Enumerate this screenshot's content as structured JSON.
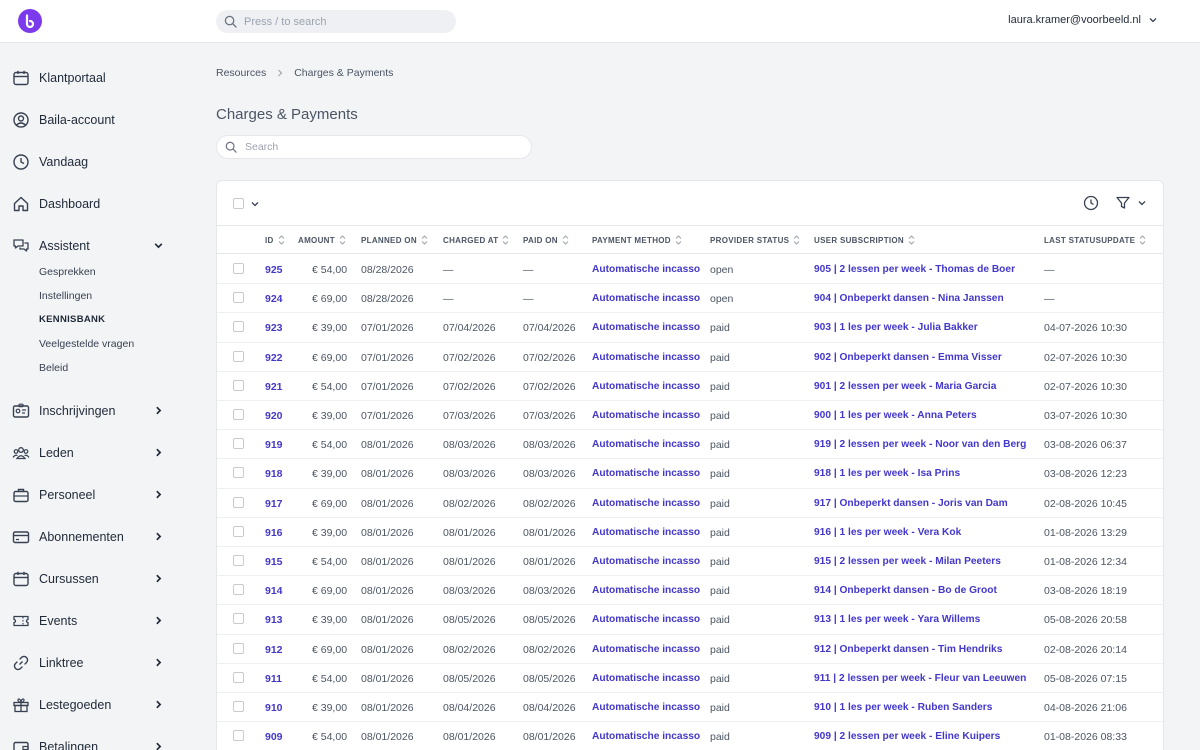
{
  "topbar": {
    "search_placeholder": "Press / to search",
    "user_email": "laura.kramer@voorbeeld.nl"
  },
  "sidebar": {
    "items": [
      {
        "label": "Klantportaal",
        "icon": "calendar-icon",
        "chevron": false
      },
      {
        "label": "Baila-account",
        "icon": "user-circle-icon",
        "chevron": false
      },
      {
        "label": "Vandaag",
        "icon": "clock-icon",
        "chevron": false
      },
      {
        "label": "Dashboard",
        "icon": "home-icon",
        "chevron": false
      },
      {
        "label": "Assistent",
        "icon": "chat-icon",
        "chevron": "down"
      },
      {
        "label": "Inschrijvingen",
        "icon": "id-card-icon",
        "chevron": "right"
      },
      {
        "label": "Leden",
        "icon": "users-icon",
        "chevron": "right"
      },
      {
        "label": "Personeel",
        "icon": "briefcase-icon",
        "chevron": "right"
      },
      {
        "label": "Abonnementen",
        "icon": "credit-card-icon",
        "chevron": "right"
      },
      {
        "label": "Cursussen",
        "icon": "calendar-icon",
        "chevron": "right"
      },
      {
        "label": "Events",
        "icon": "ticket-icon",
        "chevron": "right"
      },
      {
        "label": "Linktree",
        "icon": "link-icon",
        "chevron": "right"
      },
      {
        "label": "Lestegoeden",
        "icon": "gift-icon",
        "chevron": "right"
      },
      {
        "label": "Betalingen",
        "icon": "wallet-icon",
        "chevron": "right"
      }
    ],
    "assistent_sub": [
      {
        "label": "Gesprekken",
        "active": false
      },
      {
        "label": "Instellingen",
        "active": false
      },
      {
        "label": "KENNISBANK",
        "active": true
      },
      {
        "label": "Veelgestelde vragen",
        "active": false
      },
      {
        "label": "Beleid",
        "active": false
      }
    ]
  },
  "breadcrumb": {
    "root": "Resources",
    "current": "Charges & Payments"
  },
  "page": {
    "title": "Charges & Payments",
    "search_placeholder": "Search"
  },
  "table": {
    "columns": [
      "ID",
      "AMOUNT",
      "PLANNED ON",
      "CHARGED AT",
      "PAID ON",
      "PAYMENT METHOD",
      "PROVIDER STATUS",
      "USER SUBSCRIPTION",
      "LAST STATUSUPDATE"
    ],
    "rows": [
      {
        "id": "925",
        "amount": "€ 54,00",
        "planned": "08/28/2026",
        "charged": "—",
        "paid": "—",
        "method": "Automatische incasso",
        "status": "open",
        "subscription": "905 | 2 lessen per week - Thomas de Boer",
        "update": "—"
      },
      {
        "id": "924",
        "amount": "€ 69,00",
        "planned": "08/28/2026",
        "charged": "—",
        "paid": "—",
        "method": "Automatische incasso",
        "status": "open",
        "subscription": "904 | Onbeperkt dansen - Nina Janssen",
        "update": "—"
      },
      {
        "id": "923",
        "amount": "€ 39,00",
        "planned": "07/01/2026",
        "charged": "07/04/2026",
        "paid": "07/04/2026",
        "method": "Automatische incasso",
        "status": "paid",
        "subscription": "903 | 1 les per week - Julia Bakker",
        "update": "04-07-2026 10:30"
      },
      {
        "id": "922",
        "amount": "€ 69,00",
        "planned": "07/01/2026",
        "charged": "07/02/2026",
        "paid": "07/02/2026",
        "method": "Automatische incasso",
        "status": "paid",
        "subscription": "902 | Onbeperkt dansen - Emma Visser",
        "update": "02-07-2026 10:30"
      },
      {
        "id": "921",
        "amount": "€ 54,00",
        "planned": "07/01/2026",
        "charged": "07/02/2026",
        "paid": "07/02/2026",
        "method": "Automatische incasso",
        "status": "paid",
        "subscription": "901 | 2 lessen per week - Maria Garcia",
        "update": "02-07-2026 10:30"
      },
      {
        "id": "920",
        "amount": "€ 39,00",
        "planned": "07/01/2026",
        "charged": "07/03/2026",
        "paid": "07/03/2026",
        "method": "Automatische incasso",
        "status": "paid",
        "subscription": "900 | 1 les per week - Anna Peters",
        "update": "03-07-2026 10:30"
      },
      {
        "id": "919",
        "amount": "€ 54,00",
        "planned": "08/01/2026",
        "charged": "08/03/2026",
        "paid": "08/03/2026",
        "method": "Automatische incasso",
        "status": "paid",
        "subscription": "919 | 2 lessen per week - Noor van den Berg",
        "update": "03-08-2026 06:37"
      },
      {
        "id": "918",
        "amount": "€ 39,00",
        "planned": "08/01/2026",
        "charged": "08/03/2026",
        "paid": "08/03/2026",
        "method": "Automatische incasso",
        "status": "paid",
        "subscription": "918 | 1 les per week - Isa Prins",
        "update": "03-08-2026 12:23"
      },
      {
        "id": "917",
        "amount": "€ 69,00",
        "planned": "08/01/2026",
        "charged": "08/02/2026",
        "paid": "08/02/2026",
        "method": "Automatische incasso",
        "status": "paid",
        "subscription": "917 | Onbeperkt dansen - Joris van Dam",
        "update": "02-08-2026 10:45"
      },
      {
        "id": "916",
        "amount": "€ 39,00",
        "planned": "08/01/2026",
        "charged": "08/01/2026",
        "paid": "08/01/2026",
        "method": "Automatische incasso",
        "status": "paid",
        "subscription": "916 | 1 les per week - Vera Kok",
        "update": "01-08-2026 13:29"
      },
      {
        "id": "915",
        "amount": "€ 54,00",
        "planned": "08/01/2026",
        "charged": "08/01/2026",
        "paid": "08/01/2026",
        "method": "Automatische incasso",
        "status": "paid",
        "subscription": "915 | 2 lessen per week - Milan Peeters",
        "update": "01-08-2026 12:34"
      },
      {
        "id": "914",
        "amount": "€ 69,00",
        "planned": "08/01/2026",
        "charged": "08/03/2026",
        "paid": "08/03/2026",
        "method": "Automatische incasso",
        "status": "paid",
        "subscription": "914 | Onbeperkt dansen - Bo de Groot",
        "update": "03-08-2026 18:19"
      },
      {
        "id": "913",
        "amount": "€ 39,00",
        "planned": "08/01/2026",
        "charged": "08/05/2026",
        "paid": "08/05/2026",
        "method": "Automatische incasso",
        "status": "paid",
        "subscription": "913 | 1 les per week - Yara Willems",
        "update": "05-08-2026 20:58"
      },
      {
        "id": "912",
        "amount": "€ 69,00",
        "planned": "08/01/2026",
        "charged": "08/02/2026",
        "paid": "08/02/2026",
        "method": "Automatische incasso",
        "status": "paid",
        "subscription": "912 | Onbeperkt dansen - Tim Hendriks",
        "update": "02-08-2026 20:14"
      },
      {
        "id": "911",
        "amount": "€ 54,00",
        "planned": "08/01/2026",
        "charged": "08/05/2026",
        "paid": "08/05/2026",
        "method": "Automatische incasso",
        "status": "paid",
        "subscription": "911 | 2 lessen per week - Fleur van Leeuwen",
        "update": "05-08-2026 07:15"
      },
      {
        "id": "910",
        "amount": "€ 39,00",
        "planned": "08/01/2026",
        "charged": "08/04/2026",
        "paid": "08/04/2026",
        "method": "Automatische incasso",
        "status": "paid",
        "subscription": "910 | 1 les per week - Ruben Sanders",
        "update": "04-08-2026 21:06"
      },
      {
        "id": "909",
        "amount": "€ 54,00",
        "planned": "08/01/2026",
        "charged": "08/01/2026",
        "paid": "08/01/2026",
        "method": "Automatische incasso",
        "status": "paid",
        "subscription": "909 | 2 lessen per week - Eline Kuipers",
        "update": "01-08-2026 08:33"
      }
    ]
  }
}
